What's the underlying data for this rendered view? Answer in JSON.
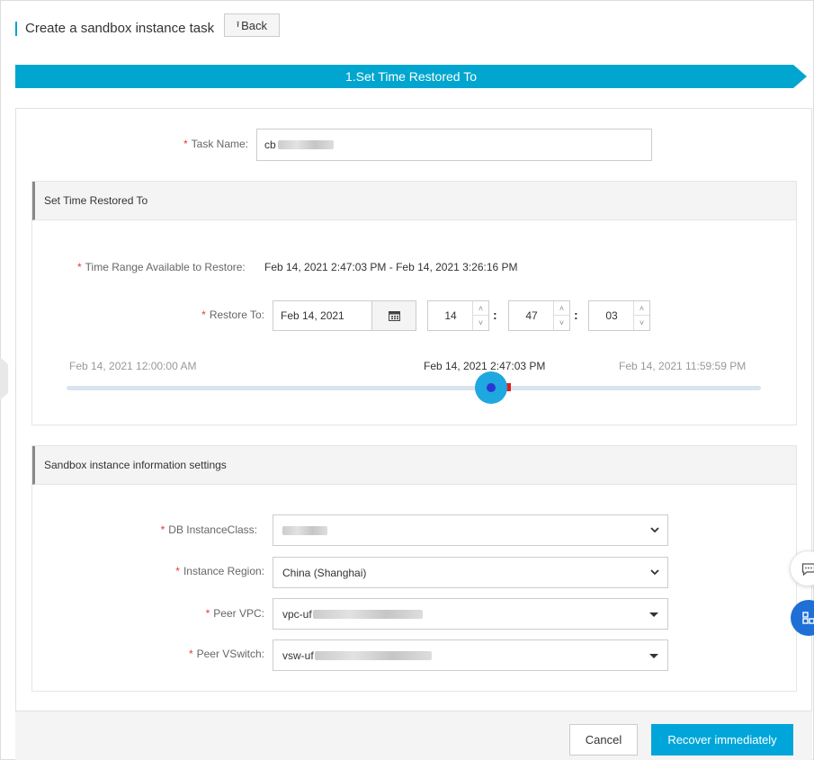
{
  "header": {
    "title": "Create a sandbox instance task",
    "back_label": "Back"
  },
  "step": {
    "label": "1.Set Time Restored To"
  },
  "task": {
    "label": "Task Name:",
    "value_prefix": "cb"
  },
  "time_panel": {
    "title": "Set Time Restored To",
    "range_label": "Time Range Available to Restore:",
    "range_value": "Feb 14, 2021 2:47:03 PM - Feb 14, 2021 3:26:16 PM",
    "restore_label": "Restore To:",
    "date_value": "Feb 14, 2021",
    "hour": "14",
    "minute": "47",
    "second": "03",
    "slider": {
      "start_label": "Feb 14, 2021 12:00:00 AM",
      "current_label": "Feb 14, 2021 2:47:03 PM",
      "end_label": "Feb 14, 2021 11:59:59 PM",
      "position_fraction": 0.616
    }
  },
  "sandbox_panel": {
    "title": "Sandbox instance information settings",
    "instance_class_label": "DB InstanceClass:",
    "region_label": "Instance Region:",
    "region_value": "China (Shanghai)",
    "vpc_label": "Peer VPC:",
    "vpc_prefix": "vpc-uf",
    "vswitch_label": "Peer VSwitch:",
    "vswitch_prefix": "vsw-uf"
  },
  "footer": {
    "cancel_label": "Cancel",
    "confirm_label": "Recover immediately"
  },
  "colors": {
    "accent": "#00a6d9",
    "required": "#e4393c",
    "slider_thumb": "#1fa7e0"
  }
}
